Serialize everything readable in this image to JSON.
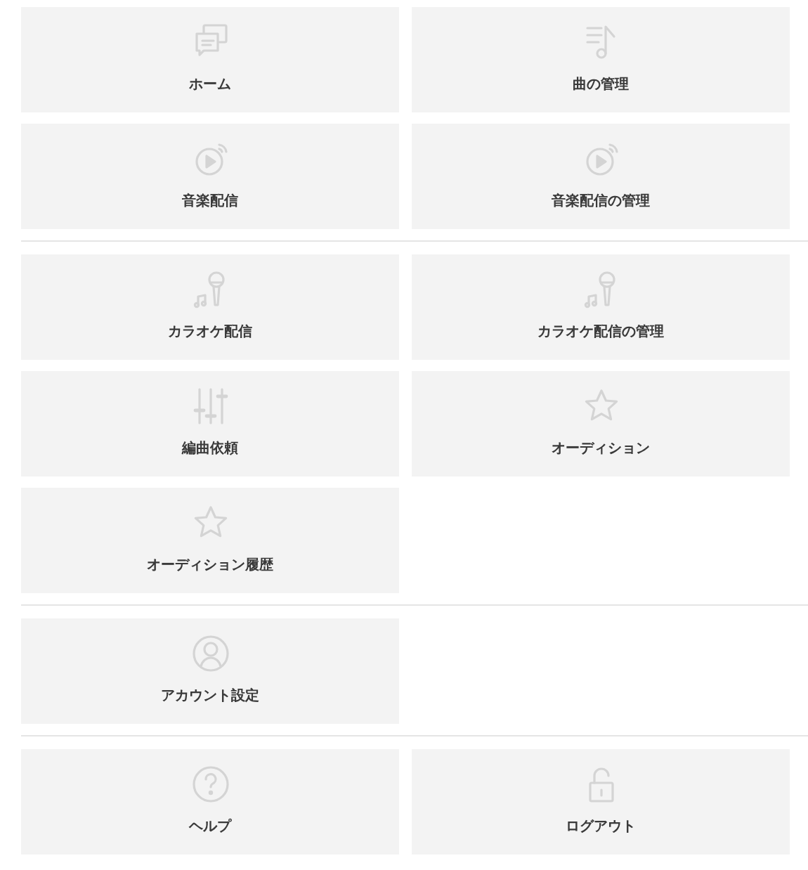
{
  "sections": [
    {
      "items": [
        {
          "label": "ホーム",
          "kind": "chat"
        },
        {
          "label": "曲の管理",
          "kind": "playlist"
        },
        {
          "label": "音楽配信",
          "kind": "stream"
        },
        {
          "label": "音楽配信の管理",
          "kind": "stream"
        }
      ]
    },
    {
      "items": [
        {
          "label": "カラオケ配信",
          "kind": "karaoke"
        },
        {
          "label": "カラオケ配信の管理",
          "kind": "karaoke"
        },
        {
          "label": "編曲依頼",
          "kind": "sliders"
        },
        {
          "label": "オーディション",
          "kind": "star"
        },
        {
          "label": "オーディション履歴",
          "kind": "star"
        }
      ]
    },
    {
      "items": [
        {
          "label": "アカウント設定",
          "kind": "user"
        }
      ]
    },
    {
      "items": [
        {
          "label": "ヘルプ",
          "kind": "help"
        },
        {
          "label": "ログアウト",
          "kind": "lock"
        }
      ]
    }
  ]
}
